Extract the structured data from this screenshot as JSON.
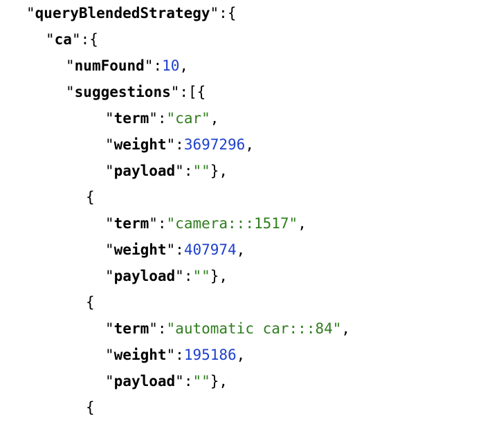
{
  "json_viewer": {
    "root_key": "queryBlendedStrategy",
    "group_key": "ca",
    "num_found_key": "numFound",
    "num_found_value": "10",
    "suggestions_key": "suggestions",
    "term_key": "term",
    "weight_key": "weight",
    "payload_key": "payload",
    "empty_string": "\"\"",
    "suggestions": [
      {
        "term": "\"car\"",
        "weight": "3697296"
      },
      {
        "term": "\"camera:::1517\"",
        "weight": "407974"
      },
      {
        "term": "\"automatic car:::84\"",
        "weight": "195186"
      }
    ],
    "colors": {
      "key": "#000000",
      "string": "#2f7d1e",
      "number": "#1c3fcc"
    }
  }
}
